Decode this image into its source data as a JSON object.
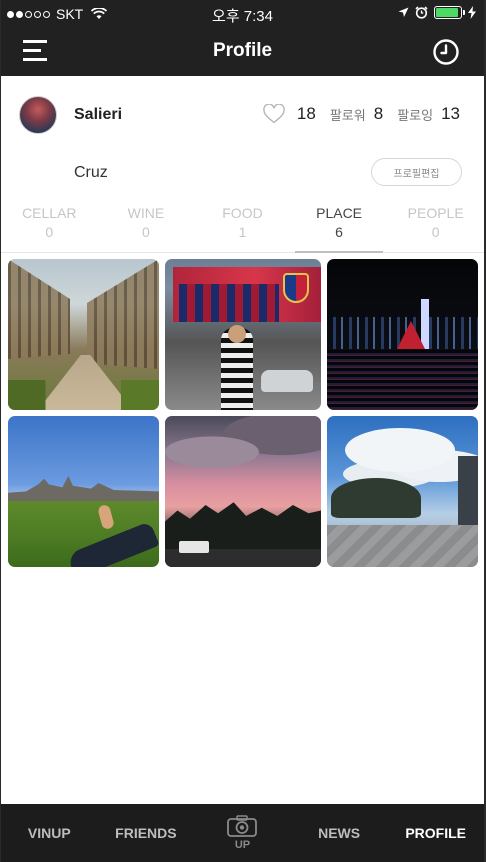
{
  "status_bar": {
    "carrier": "SKT",
    "time": "오후 7:34",
    "signal_dots_filled": 2,
    "signal_dots_total": 5,
    "battery_level": 0.9,
    "icons": [
      "wifi-icon",
      "location-arrow-icon",
      "alarm-icon",
      "battery-icon",
      "charging-icon"
    ]
  },
  "nav": {
    "title": "Profile",
    "left_icon": "menu-icon",
    "right_icon": "clock-icon"
  },
  "profile": {
    "username": "Salieri",
    "real_name": "Cruz",
    "likes": "18",
    "followers_label": "팔로워",
    "followers": "8",
    "following_label": "팔로잉",
    "following": "13",
    "edit_button": "프로필편집"
  },
  "tabs": [
    {
      "label": "CELLAR",
      "count": "0",
      "active": false
    },
    {
      "label": "WINE",
      "count": "0",
      "active": false
    },
    {
      "label": "FOOD",
      "count": "1",
      "active": false
    },
    {
      "label": "PLACE",
      "count": "6",
      "active": true
    },
    {
      "label": "PEOPLE",
      "count": "0",
      "active": false
    }
  ],
  "photos": [
    {
      "name": "photo-tree-avenue"
    },
    {
      "name": "photo-stadium-fcb"
    },
    {
      "name": "photo-night-skyline"
    },
    {
      "name": "photo-city-lawn"
    },
    {
      "name": "photo-pink-sunset"
    },
    {
      "name": "photo-promenade"
    }
  ],
  "tabbar": {
    "items": [
      {
        "label": "VINUP",
        "active": false
      },
      {
        "label": "FRIENDS",
        "active": false
      },
      {
        "label": "UP",
        "active": false
      },
      {
        "label": "NEWS",
        "active": false
      },
      {
        "label": "PROFILE",
        "active": true
      }
    ]
  },
  "colors": {
    "bar_bg": "#212121",
    "tabbar_bg": "#1c1c1c",
    "battery_green": "#4cd964",
    "inactive_tab": "#c6c6c6"
  }
}
